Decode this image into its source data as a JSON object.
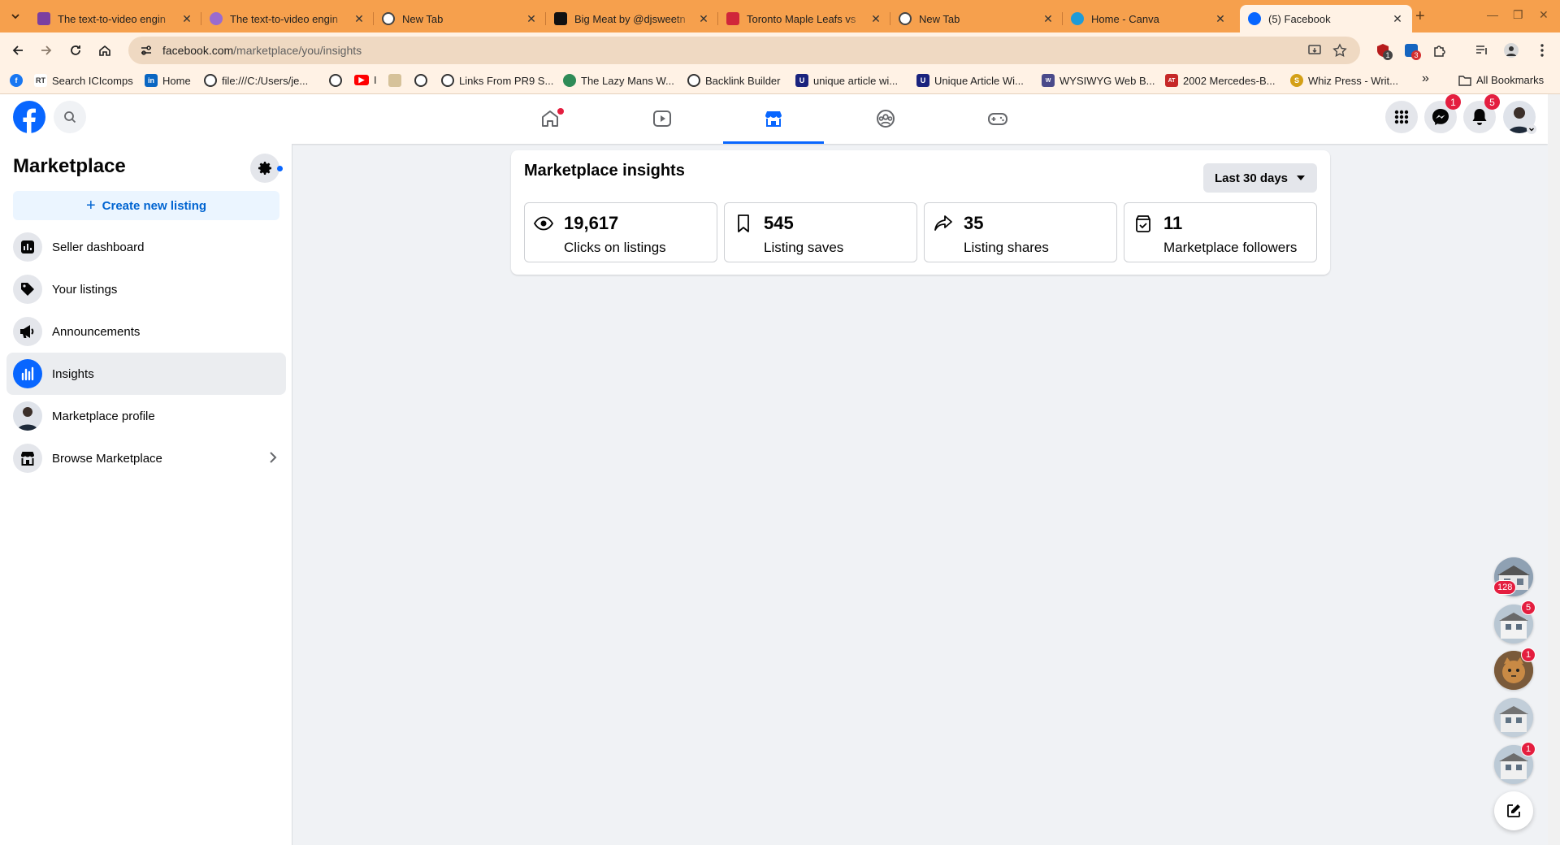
{
  "browser": {
    "tabs": [
      {
        "title": "The text-to-video engin",
        "favicon_color": "#7b3fa0",
        "active": false
      },
      {
        "title": "The text-to-video engin",
        "favicon_color": "#9a6bd0",
        "active": false
      },
      {
        "title": "New Tab",
        "favicon_color": "#444444",
        "active": false
      },
      {
        "title": "Big Meat by @djsweetn",
        "favicon_color": "#111111",
        "active": false
      },
      {
        "title": "Toronto Maple Leafs vs",
        "favicon_color": "#d0263a",
        "active": false
      },
      {
        "title": "New Tab",
        "favicon_color": "#444444",
        "active": false
      },
      {
        "title": "Home - Canva",
        "favicon_color": "#1f9bd8",
        "active": false
      },
      {
        "title": "(5) Facebook",
        "favicon_color": "#0866ff",
        "active": true
      }
    ],
    "url_domain": "facebook.com",
    "url_path": "/marketplace/you/insights",
    "extension_badges": [
      "1",
      "3"
    ],
    "bookmarks": [
      {
        "label": "",
        "icon": "facebook-icon",
        "color": "#1877f2"
      },
      {
        "label": "Search ICIcomps",
        "icon": "rt-icon",
        "color": "#555555"
      },
      {
        "label": "Home",
        "icon": "linkedin-icon",
        "color": "#0a66c2"
      },
      {
        "label": "file:///C:/Users/je...",
        "icon": "globe-icon",
        "color": "#333333"
      },
      {
        "label": "",
        "icon": "globe-icon",
        "color": "#333333"
      },
      {
        "label": "I",
        "icon": "youtube-icon",
        "color": "#ff0000"
      },
      {
        "label": "",
        "icon": "image-icon",
        "color": "#d6c29a"
      },
      {
        "label": "",
        "icon": "globe-icon",
        "color": "#333333"
      },
      {
        "label": "Links From PR9 S...",
        "icon": "globe-icon",
        "color": "#333333"
      },
      {
        "label": "The Lazy Mans W...",
        "icon": "earth-icon",
        "color": "#2e8b57"
      },
      {
        "label": "Backlink Builder",
        "icon": "globe-icon",
        "color": "#333333"
      },
      {
        "label": "unique article wi...",
        "icon": "u-icon",
        "color": "#1a237e"
      },
      {
        "label": "Unique Article Wi...",
        "icon": "u-icon",
        "color": "#1a237e"
      },
      {
        "label": "WYSIWYG Web B...",
        "icon": "wysiwyg-icon",
        "color": "#4a4a8a"
      },
      {
        "label": "2002 Mercedes-B...",
        "icon": "autotrader-icon",
        "color": "#c62828"
      },
      {
        "label": "Whiz Press - Writ...",
        "icon": "whiz-icon",
        "color": "#d4a017"
      }
    ],
    "overflow_label": "»",
    "all_bookmarks": "All Bookmarks"
  },
  "fb": {
    "brand_color": "#0866ff",
    "nav": [
      "home-icon",
      "video-icon",
      "marketplace-icon",
      "groups-icon",
      "gaming-icon"
    ],
    "messenger_badge": "1",
    "notifications_badge": "5"
  },
  "sidebar": {
    "title": "Marketplace",
    "create_label": "Create new listing",
    "items": [
      {
        "label": "Seller dashboard",
        "icon": "dashboard-icon"
      },
      {
        "label": "Your listings",
        "icon": "tag-icon"
      },
      {
        "label": "Announcements",
        "icon": "megaphone-icon"
      },
      {
        "label": "Insights",
        "icon": "bar-chart-icon",
        "active": true
      },
      {
        "label": "Marketplace profile",
        "icon": "profile-avatar"
      },
      {
        "label": "Browse Marketplace",
        "icon": "storefront-icon"
      }
    ]
  },
  "insights": {
    "title": "Marketplace insights",
    "range": "Last 30 days",
    "stats": [
      {
        "value": "19,617",
        "label": "Clicks on listings",
        "icon": "eye-icon"
      },
      {
        "value": "545",
        "label": "Listing saves",
        "icon": "bookmark-icon"
      },
      {
        "value": "35",
        "label": "Listing shares",
        "icon": "share-icon"
      },
      {
        "value": "11",
        "label": "Marketplace followers",
        "icon": "follower-icon"
      }
    ]
  },
  "chatheads": [
    {
      "badge": "128"
    },
    {
      "badge": "5"
    },
    {
      "badge": "1"
    },
    {
      "badge": ""
    },
    {
      "badge": "1"
    }
  ]
}
